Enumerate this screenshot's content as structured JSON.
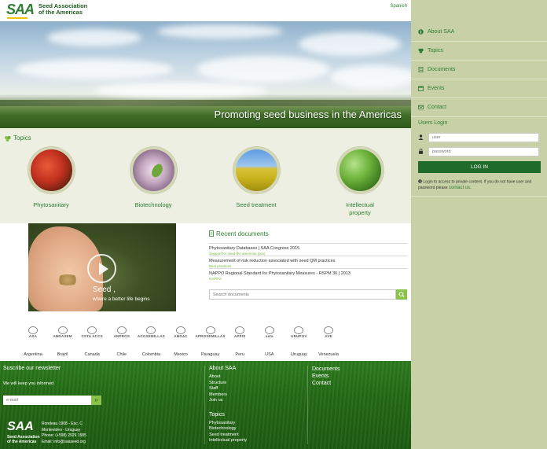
{
  "header": {
    "logo_mark": "SAA",
    "logo_line1": "Seed Association",
    "logo_line2": "of the Americas",
    "language": "Spanish"
  },
  "hero": {
    "tagline": "Promoting seed business in the Americas"
  },
  "topics": {
    "heading": "Topics",
    "items": [
      {
        "label": "Phytosanitary"
      },
      {
        "label": "Biotechnology"
      },
      {
        "label": "Seed treatment"
      },
      {
        "label": "Intellectual property"
      }
    ]
  },
  "video": {
    "caption_main": "Seed ,",
    "caption_sub": "where a better life begins"
  },
  "recent_documents": {
    "heading": "Recent documents",
    "items": [
      {
        "title": "Phytosanitary Databases | SAA Congress 2015",
        "category": "Support for seed the americas (pcs)"
      },
      {
        "title": "Measurement of risk reduction associated with seed QM practices",
        "category": "Best practices"
      },
      {
        "title": "NAPPO Regional Standard for Phytosanitary Measures - RSPM 36 | 2013",
        "category": "NAPPO"
      }
    ],
    "search_placeholder": "Search documents"
  },
  "members": [
    {
      "logo": "ASA",
      "country": "Argentina"
    },
    {
      "logo": "ABRASEM",
      "country": "Brazil"
    },
    {
      "logo": "CSTA ACCS",
      "country": "Canada"
    },
    {
      "logo": "ANPROS",
      "country": "Chile"
    },
    {
      "logo": "ACOSEMILLAS",
      "country": "Colombia"
    },
    {
      "logo": "AMSAC",
      "country": "Mexico"
    },
    {
      "logo": "APROSEMILLAS",
      "country": "Paraguay"
    },
    {
      "logo": "APPIS",
      "country": "Peru"
    },
    {
      "logo": "asta",
      "country": "USA"
    },
    {
      "logo": "URUPOV",
      "country": "Uruguay"
    },
    {
      "logo": "AVE",
      "country": "Venezuela"
    }
  ],
  "footer": {
    "newsletter_title": "Suscribe our newsletter",
    "newsletter_sub": "We will keep you informed",
    "email_placeholder": "e-mail",
    "submit_glyph": "»",
    "logo_mark": "SAA",
    "logo_line1": "Seed Association",
    "logo_line2": "of the Americas",
    "address": [
      "Rondeau 1908 - Esc. C",
      "Montevideo - Uruguay",
      "Phone: (+598) 2929 1585",
      "Email: info@saaseed.org"
    ],
    "about_title": "About SAA",
    "about_items": [
      "About",
      "Structure",
      "Staff",
      "Members",
      "Join us"
    ],
    "topics_title": "Topics",
    "topics_items": [
      "Phytosanitary",
      "Biotechnology",
      "Seed treatment",
      "Intellectual property"
    ],
    "right_links": [
      "Documents",
      "Events",
      "Contact"
    ]
  },
  "side": {
    "nav": [
      {
        "label": "About SAA",
        "icon": "info-icon"
      },
      {
        "label": "Topics",
        "icon": "leaf-icon"
      },
      {
        "label": "Documents",
        "icon": "document-icon"
      },
      {
        "label": "Events",
        "icon": "calendar-icon"
      },
      {
        "label": "Contact",
        "icon": "envelope-icon"
      }
    ],
    "login_title": "Users Login",
    "user_placeholder": "user",
    "password_placeholder": "password",
    "login_button": "LOG IN",
    "login_note": "Login to access to private content. If you do not have user and password please",
    "login_link": "contact us."
  },
  "colors": {
    "brand_green": "#2e7d32",
    "accent_lime": "#8bc34a",
    "side_panel": "#c8d1a6",
    "footer_green": "#246b16"
  }
}
